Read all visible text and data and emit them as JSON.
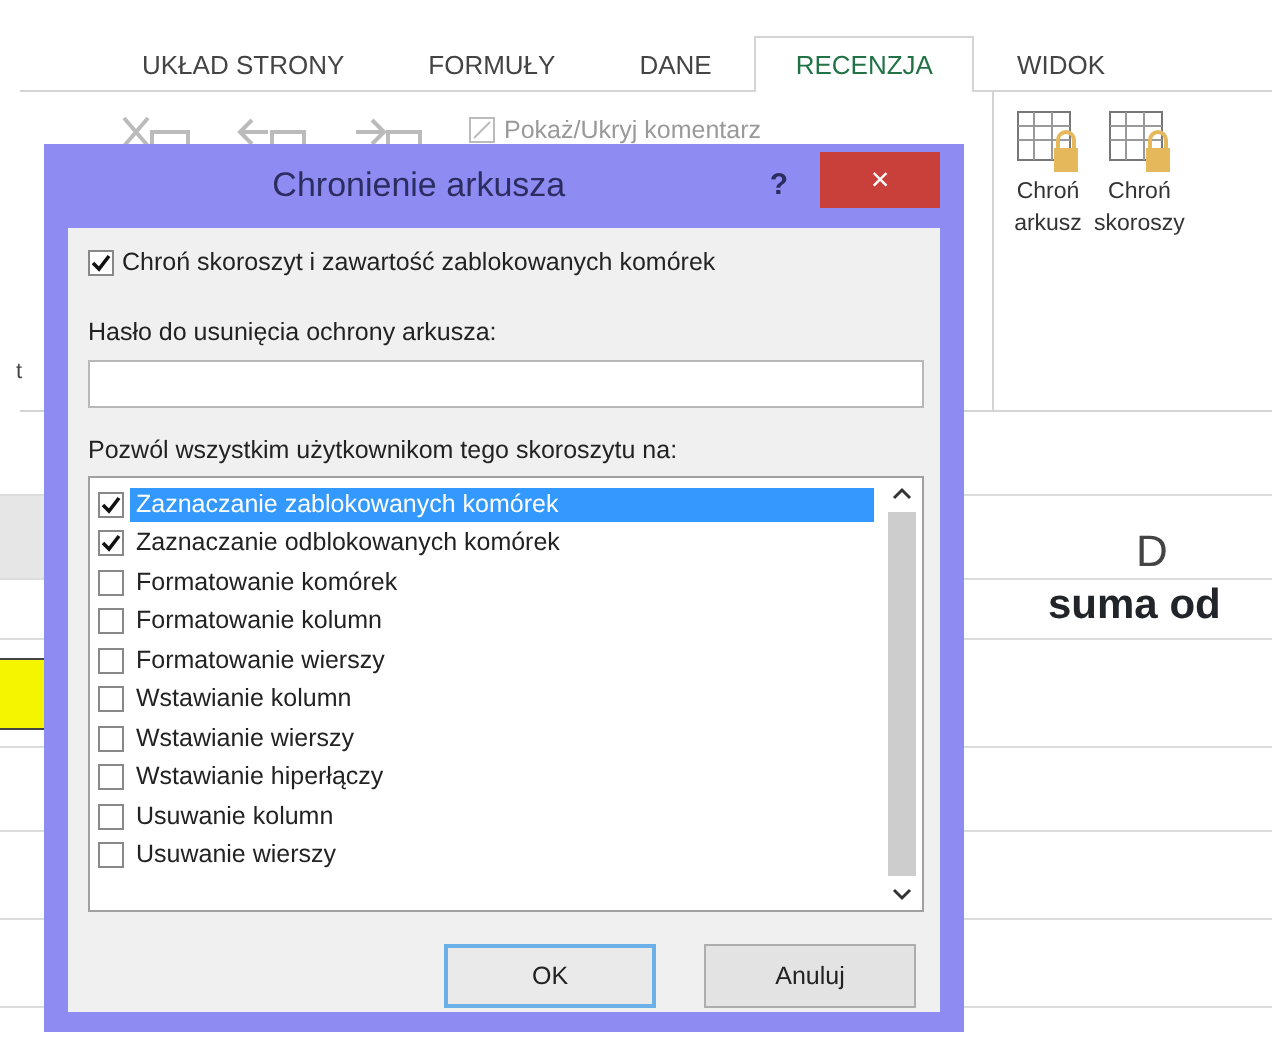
{
  "ribbon_tabs": [
    {
      "label": "UKŁAD STRONY",
      "selected": false
    },
    {
      "label": "FORMUŁY",
      "selected": false
    },
    {
      "label": "DANE",
      "selected": false
    },
    {
      "label": "RECENZJA",
      "selected": true
    },
    {
      "label": "WIDOK",
      "selected": false
    }
  ],
  "ribbon": {
    "comment_toggle": "Pokaż/Ukryj komentarz",
    "left_fragment": "t",
    "protect_buttons": [
      {
        "label": "Chroń",
        "sublabel": "arkusz"
      },
      {
        "label": "Chroń",
        "sublabel": "skoroszy"
      }
    ]
  },
  "sheet": {
    "column_header": "D",
    "header_cell": "suma od"
  },
  "dialog": {
    "title": "Chronienie arkusza",
    "help": "?",
    "close": "×",
    "protect_option": {
      "label": "Chroń skoroszyt i zawartość zablokowanych komórek",
      "checked": true
    },
    "password": {
      "label": "Hasło do usunięcia ochrony arkusza:"
    },
    "permissions_label": "Pozwól wszystkim użytkownikom tego skoroszytu na:",
    "permissions": [
      {
        "label": "Zaznaczanie zablokowanych komórek",
        "checked": true,
        "selected": true
      },
      {
        "label": "Zaznaczanie odblokowanych komórek",
        "checked": true,
        "selected": false
      },
      {
        "label": "Formatowanie komórek",
        "checked": false,
        "selected": false
      },
      {
        "label": "Formatowanie kolumn",
        "checked": false,
        "selected": false
      },
      {
        "label": "Formatowanie wierszy",
        "checked": false,
        "selected": false
      },
      {
        "label": "Wstawianie kolumn",
        "checked": false,
        "selected": false
      },
      {
        "label": "Wstawianie wierszy",
        "checked": false,
        "selected": false
      },
      {
        "label": "Wstawianie hiperłączy",
        "checked": false,
        "selected": false
      },
      {
        "label": "Usuwanie kolumn",
        "checked": false,
        "selected": false
      },
      {
        "label": "Usuwanie wierszy",
        "checked": false,
        "selected": false
      }
    ],
    "buttons": [
      {
        "label": "OK",
        "default": true
      },
      {
        "label": "Anuluj",
        "default": false
      }
    ]
  }
}
